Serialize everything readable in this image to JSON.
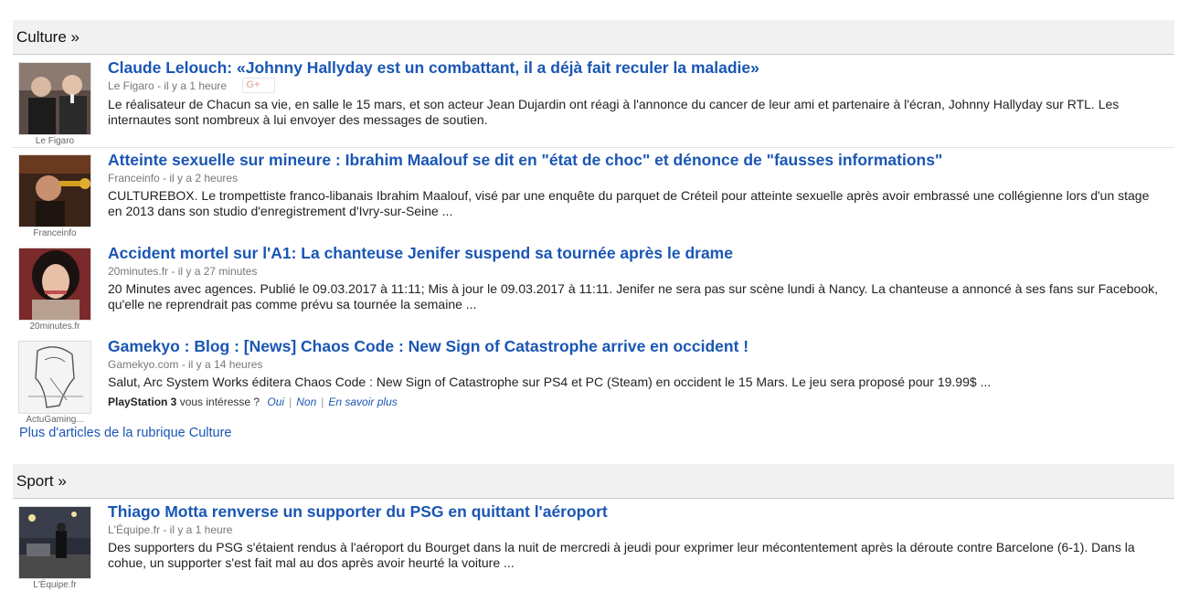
{
  "sections": [
    {
      "title": "Culture »",
      "more_link": "Plus d'articles de la rubrique Culture",
      "articles": [
        {
          "title": "Claude Lelouch: «Johnny Hallyday est un combattant, il a déjà fait reculer la maladie»",
          "meta": "Le Figaro - il y a 1 heure",
          "thumb_source": "Le Figaro",
          "gplus": "G+",
          "snippet": "Le réalisateur de Chacun sa vie, en salle le 15 mars, et son acteur Jean Dujardin ont réagi à l'annonce du cancer de leur ami et partenaire à l'écran, Johnny Hallyday sur RTL. Les internautes sont nombreux à lui envoyer des messages de soutien."
        },
        {
          "title": "Atteinte sexuelle sur mineure : Ibrahim Maalouf se dit en \"état de choc\" et dénonce de \"fausses informations\"",
          "meta": "Franceinfo - il y a 2 heures",
          "thumb_source": "Franceinfo",
          "snippet": "CULTUREBOX. Le trompettiste franco-libanais Ibrahim Maalouf, visé par une enquête du parquet de Créteil pour atteinte sexuelle après avoir embrassé une collégienne lors d'un stage en 2013 dans son studio d'enregistrement d'Ivry-sur-Seine ..."
        },
        {
          "title": "Accident mortel sur l'A1: La chanteuse Jenifer suspend sa tournée après le drame",
          "meta": "20minutes.fr - il y a 27 minutes",
          "thumb_source": "20minutes.fr",
          "snippet": "20 Minutes avec agences. Publié le 09.03.2017 à 11:11; Mis à jour le 09.03.2017 à 11:11. Jenifer ne sera pas sur scène lundi à Nancy. La chanteuse a annoncé à ses fans sur Facebook, qu'elle ne reprendrait pas comme prévu sa tournée la semaine ..."
        },
        {
          "title": "Gamekyo : Blog : [News] Chaos Code : New Sign of Catastrophe arrive en occident !",
          "meta": "Gamekyo.com - il y a 14 heures",
          "thumb_source": "ActuGaming...",
          "snippet": "Salut, Arc System Works éditera Chaos Code : New Sign of Catastrophe sur PS4 et PC (Steam) en occident le 15 Mars. Le jeu sera proposé pour 19.99$ ...",
          "interest": {
            "topic": "PlayStation 3",
            "question": " vous intéresse ?",
            "yes": "Oui",
            "no": "Non",
            "learn_more": "En savoir plus"
          }
        }
      ]
    },
    {
      "title": "Sport »",
      "articles": [
        {
          "title": "Thiago Motta renverse un supporter du PSG en quittant l'aéroport",
          "meta": "L'Équipe.fr - il y a 1 heure",
          "thumb_source": "L'Équipe.fr",
          "snippet": "Des supporters du PSG s'étaient rendus à l'aéroport du Bourget dans la nuit de mercredi à jeudi pour exprimer leur mécontentement après la déroute contre Barcelone (6-1). Dans la cohue, un supporter s'est fait mal au dos après avoir heurté la voiture ..."
        }
      ]
    }
  ],
  "colors": {
    "link": "#1a56b4",
    "header_bg": "#f1f1f1",
    "meta": "#777777"
  }
}
